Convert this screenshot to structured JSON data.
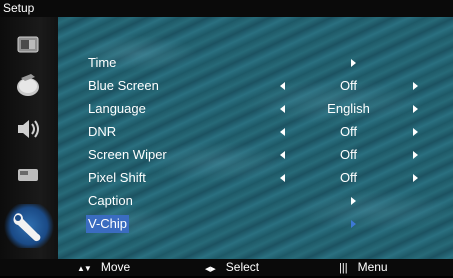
{
  "title": "Setup",
  "sidebar": {
    "items": [
      {
        "icon": "picture-icon"
      },
      {
        "icon": "sound-disc-icon"
      },
      {
        "icon": "speaker-icon"
      },
      {
        "icon": "input-device-icon"
      },
      {
        "icon": "wrench-icon",
        "selected": true
      }
    ]
  },
  "menu": {
    "items": [
      {
        "label": "Time",
        "value": ""
      },
      {
        "label": "Blue Screen",
        "value": "Off"
      },
      {
        "label": "Language",
        "value": "English"
      },
      {
        "label": "DNR",
        "value": "Off"
      },
      {
        "label": "Screen Wiper",
        "value": "Off"
      },
      {
        "label": "Pixel Shift",
        "value": "Off"
      },
      {
        "label": "Caption",
        "value": ""
      },
      {
        "label": "V-Chip",
        "value": "",
        "selected": true
      }
    ]
  },
  "footer": {
    "move_label": "Move",
    "select_label": "Select",
    "menu_label": "Menu",
    "move_symbol": "▲▼",
    "select_symbol": "◀▶",
    "menu_symbol": "|||"
  },
  "colors": {
    "highlight": "#3a6cc0",
    "background": "#235f6d"
  }
}
